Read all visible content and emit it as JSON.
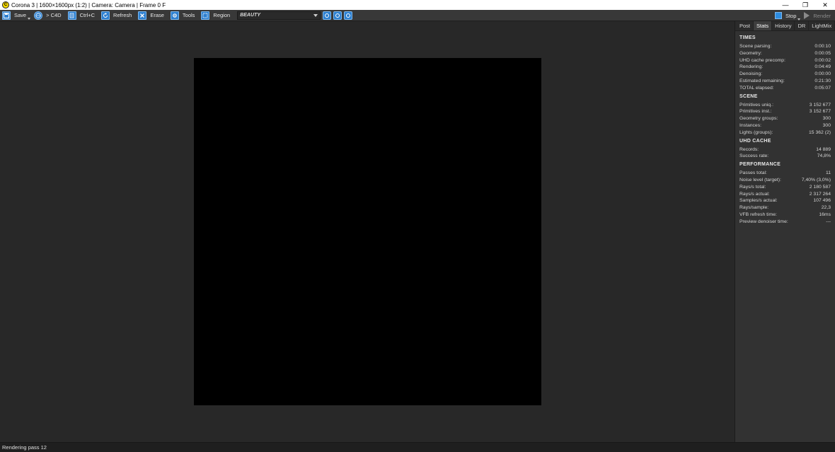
{
  "window": {
    "title": "Corona 3 | 1600×1600px (1:2) | Camera: Camera | Frame 0 F",
    "app_icon_glyph": "C",
    "minimize_glyph": "—",
    "maximize_glyph": "❐",
    "close_glyph": "✕"
  },
  "toolbar": {
    "save_label": "Save",
    "c4d_label": "> C4D",
    "copy_label": "Ctrl+C",
    "refresh_label": "Refresh",
    "erase_label": "Erase",
    "tools_label": "Tools",
    "region_label": "Region",
    "pass_value": "BEAUTY",
    "stop_label": "Stop",
    "render_label": "Render",
    "icons": {
      "save": "save-icon",
      "c4d": "globe-icon",
      "copy": "copy-icon",
      "refresh": "refresh-icon",
      "erase": "erase-icon",
      "tools": "gear-icon",
      "region": "region-icon",
      "zoom_in": "zoom-in-icon",
      "zoom_out": "zoom-out-icon",
      "zoom_fit": "zoom-fit-icon"
    },
    "accent_color": "#2d7fcf"
  },
  "sidepanel": {
    "tabs": [
      {
        "label": "Post"
      },
      {
        "label": "Stats",
        "active": true
      },
      {
        "label": "History"
      },
      {
        "label": "DR"
      },
      {
        "label": "LightMix"
      }
    ],
    "sections": [
      {
        "title": "TIMES",
        "rows": [
          {
            "label": "Scene parsing:",
            "value": "0:00:10"
          },
          {
            "label": "Geometry:",
            "value": "0:00:05"
          },
          {
            "label": "UHD cache precomp:",
            "value": "0:00:02"
          },
          {
            "label": "Rendering:",
            "value": "0:04:49"
          },
          {
            "label": "Denoising:",
            "value": "0:00:00"
          },
          {
            "label": "Estimated remaining:",
            "value": "0:21:30"
          },
          {
            "label": "TOTAL elapsed:",
            "value": "0:05:07"
          }
        ]
      },
      {
        "title": "SCENE",
        "rows": [
          {
            "label": "Primitives uniq.:",
            "value": "3 152 677"
          },
          {
            "label": "Primitives inst.:",
            "value": "3 152 677"
          },
          {
            "label": "Geometry groups:",
            "value": "300"
          },
          {
            "label": "Instances:",
            "value": "300"
          },
          {
            "label": "Lights (groups):",
            "value": "15 362 (2)"
          }
        ]
      },
      {
        "title": "UHD CACHE",
        "rows": [
          {
            "label": "Records:",
            "value": "14 889"
          },
          {
            "label": "Success rate:",
            "value": "74,8%"
          }
        ]
      },
      {
        "title": "PERFORMANCE",
        "rows": [
          {
            "label": "Passes total:",
            "value": "11"
          },
          {
            "label": "Noise level (target):",
            "value": "7,40% (3,0%)"
          },
          {
            "label": "Rays/s total:",
            "value": "2 180 587"
          },
          {
            "label": "Rays/s actual:",
            "value": "2 317 264"
          },
          {
            "label": "Samples/s actual:",
            "value": "107 496"
          },
          {
            "label": "Rays/sample:",
            "value": "22,3"
          },
          {
            "label": "VFB refresh time:",
            "value": "16ms"
          },
          {
            "label": "Preview denoiser time:",
            "value": "---"
          }
        ]
      }
    ]
  },
  "status": {
    "text": "Rendering pass 12"
  }
}
